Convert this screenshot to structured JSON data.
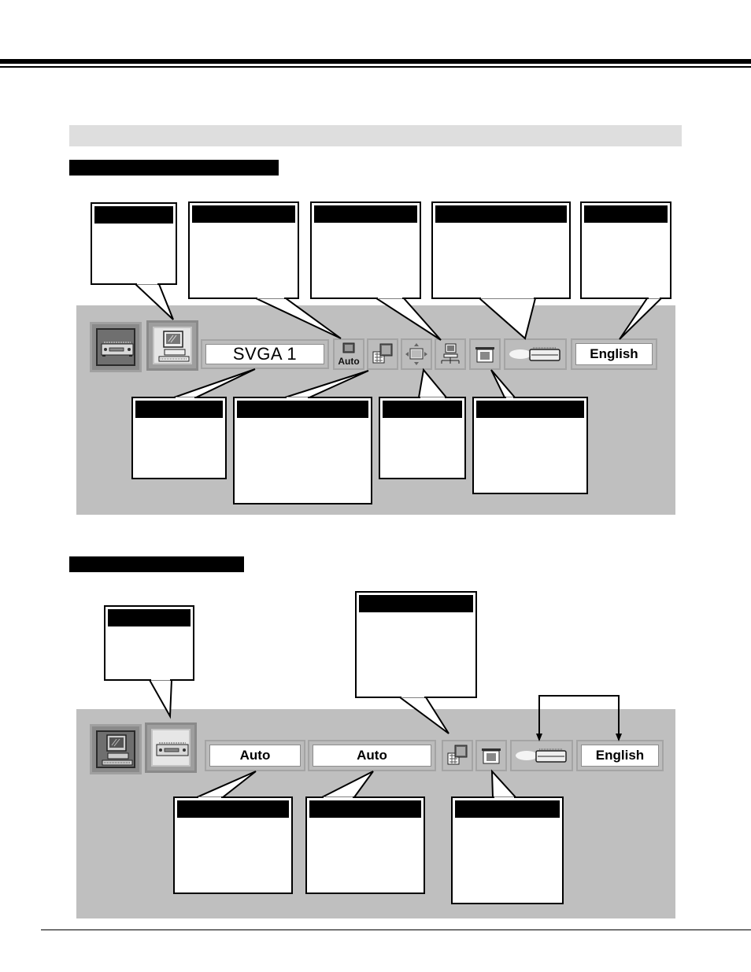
{
  "page": {
    "title_band_text": "",
    "section_computer_label": "",
    "section_video_label": ""
  },
  "computer_menu": {
    "source_buttons": [
      {
        "name": "video-source",
        "icon": "vcr-icon",
        "state": "inactive"
      },
      {
        "name": "computer-source",
        "icon": "computer-icon",
        "state": "active"
      }
    ],
    "system_value": "SVGA 1",
    "items": [
      {
        "name": "auto-pc-adjust",
        "icon": "auto-pc-adjust-icon",
        "label": "Auto"
      },
      {
        "name": "image-select",
        "icon": "image-select-icon"
      },
      {
        "name": "position-adjust",
        "icon": "position-adjust-icon"
      },
      {
        "name": "pc-adjust",
        "icon": "pc-adjust-icon"
      },
      {
        "name": "screen-menu",
        "icon": "screen-icon"
      },
      {
        "name": "lamp-setting",
        "icon": "projector-lamp-icon"
      }
    ],
    "language_value": "English",
    "callouts_top": [
      "",
      "",
      "",
      "",
      ""
    ],
    "callouts_bottom": [
      "",
      "",
      "",
      ""
    ]
  },
  "video_menu": {
    "source_buttons": [
      {
        "name": "computer-source",
        "icon": "computer-icon",
        "state": "inactive"
      },
      {
        "name": "video-source",
        "icon": "vcr-icon",
        "state": "active"
      }
    ],
    "system_value": "Auto",
    "color_system_value": "Auto",
    "items": [
      {
        "name": "image-select",
        "icon": "image-select-icon"
      },
      {
        "name": "screen-menu",
        "icon": "screen-icon"
      },
      {
        "name": "lamp-setting",
        "icon": "projector-lamp-icon"
      }
    ],
    "language_value": "English",
    "callouts_top": [
      "",
      ""
    ],
    "callouts_bottom": [
      "",
      "",
      ""
    ]
  },
  "colors": {
    "panel": "#bfbfbf",
    "title_band": "#dedede",
    "ink": "#000000"
  }
}
